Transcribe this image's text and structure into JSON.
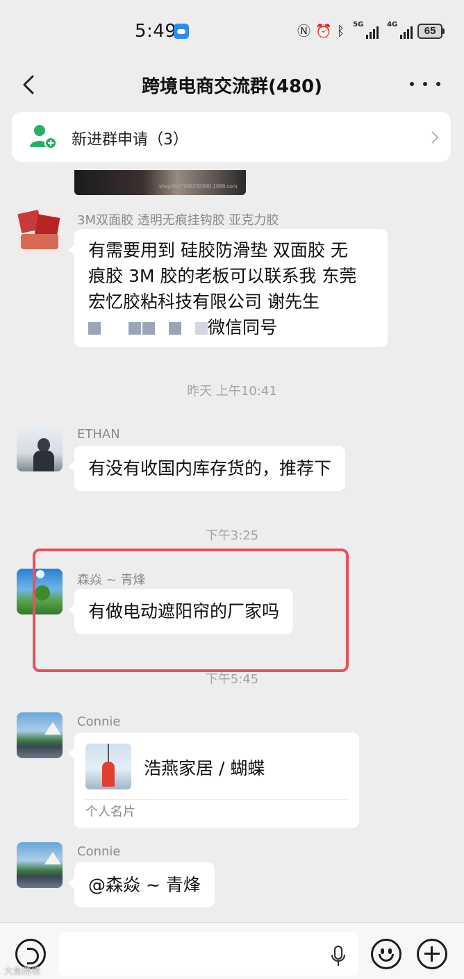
{
  "status_bar": {
    "time": "5:49",
    "signal1_label": "5G",
    "signal2_label": "4G",
    "battery": "65",
    "icons": [
      "weather-icon",
      "nfc-icon",
      "alarm-icon",
      "bluetooth-icon",
      "signal-icon",
      "battery-icon"
    ]
  },
  "nav": {
    "title": "跨境电商交流群(480)"
  },
  "join_banner": {
    "label": "新进群申请（3）"
  },
  "clipped_image": {
    "caption": "shop4867998282990.1688.com"
  },
  "messages": {
    "m1": {
      "sender": "3M双面胶 透明无痕挂钩胶 亚克力胶",
      "text": "有需要用到 硅胶防滑垫  双面胶 无\n痕胶 3M 胶的老板可以联系我 东莞\n宏忆胶粘科技有限公司 谢先生",
      "text_tail": "微信同号"
    },
    "time1": "昨天 上午10:41",
    "m2": {
      "sender": "ETHAN",
      "text": "有没有收国内库存货的，推荐下"
    },
    "time2": "下午3:25",
    "m3": {
      "sender": "森焱 ~ 青烽",
      "text": "有做电动遮阳帘的厂家吗"
    },
    "time3": "下午5:45",
    "m4": {
      "sender": "Connie",
      "card_name": "浩燕家居 / 蝴蝶",
      "card_type": "个人名片"
    },
    "m5": {
      "sender": "Connie",
      "text": "@森焱 ~ 青烽"
    }
  },
  "input_bar": {
    "placeholder": ""
  },
  "watermark": "大鱼跨境",
  "colors": {
    "background": "#ededed",
    "bubble": "#ffffff",
    "highlight": "#e7515a",
    "join_icon": "#2aae67"
  }
}
